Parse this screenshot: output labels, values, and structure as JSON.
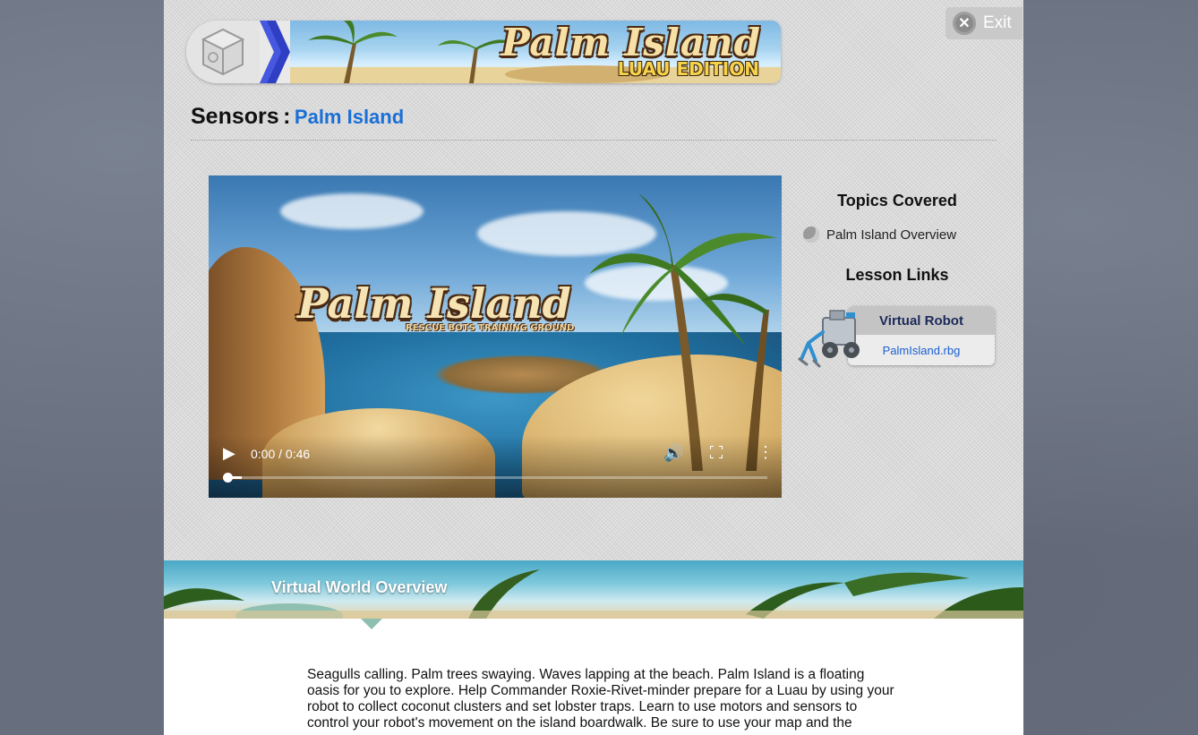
{
  "header": {
    "banner_title": "Palm Island",
    "banner_subtitle": "LUAU EDITION",
    "exit_label": "Exit"
  },
  "page": {
    "section": "Sensors",
    "separator": ":",
    "lesson_link": "Palm Island"
  },
  "video": {
    "title_overlay": "Palm Island",
    "subtitle_overlay": "RESCUE BOTS TRAINING GROUND",
    "time": "0:00 / 0:46",
    "progress": 0.0
  },
  "sidebar": {
    "topics_heading": "Topics Covered",
    "topics": [
      "Palm Island Overview"
    ],
    "links_heading": "Lesson Links",
    "link_card_title": "Virtual Robot",
    "link_card_file": "PalmIsland.rbg"
  },
  "overview": {
    "heading": "Virtual World Overview",
    "text": "Seagulls calling. Palm trees swaying. Waves lapping at the beach. Palm Island is a floating oasis for you to explore. Help Commander Roxie-Rivet-minder prepare for a Luau by using your robot to collect coconut clusters and set lobster traps. Learn to use motors and sensors to control your robot's movement on the island boardwalk. Be sure to use your map and the"
  },
  "colors": {
    "link_blue": "#1a6fd6",
    "banner_chevron": "#2f3fc4"
  }
}
